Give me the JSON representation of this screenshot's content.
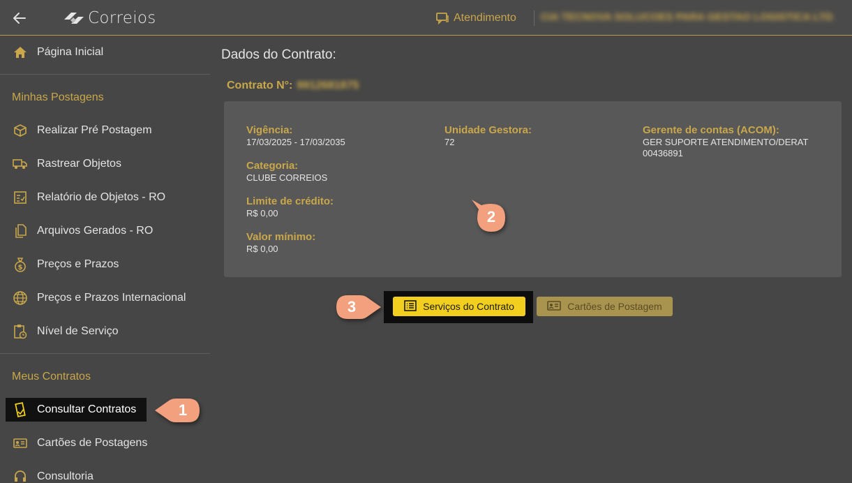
{
  "header": {
    "logo_text": "Correios",
    "atendimento_label": "Atendimento",
    "company_name": "CIA TECNOVA SOLUCOES PARA GESTAO LOGISTICA LTDA"
  },
  "sidebar": {
    "home_label": "Página Inicial",
    "section_postagens": "Minhas Postagens",
    "items_postagens": [
      {
        "label": "Realizar Pré Postagem",
        "icon": "box-icon"
      },
      {
        "label": "Rastrear Objetos",
        "icon": "truck-icon"
      },
      {
        "label": "Relatório de Objetos - RO",
        "icon": "checklist-icon"
      },
      {
        "label": "Arquivos Gerados - RO",
        "icon": "files-icon"
      },
      {
        "label": "Preços e Prazos",
        "icon": "money-bag-icon"
      },
      {
        "label": "Preços e Prazos Internacional",
        "icon": "globe-icon"
      },
      {
        "label": "Nível de Serviço",
        "icon": "clipboard-clock-icon"
      }
    ],
    "section_contratos": "Meus Contratos",
    "items_contratos": [
      {
        "label": "Consultar Contratos",
        "icon": "contract-icon"
      },
      {
        "label": "Cartões de Postagens",
        "icon": "id-card-icon"
      },
      {
        "label": "Consultoria",
        "icon": "headset-icon"
      }
    ]
  },
  "main": {
    "title": "Dados do Contrato:",
    "contract_label": "Contrato N°:",
    "contract_number": "9912681875",
    "fields": {
      "vigencia_label": "Vigência:",
      "vigencia_value": "17/03/2025 - 17/03/2035",
      "categoria_label": "Categoria:",
      "categoria_value": "CLUBE CORREIOS",
      "limite_label": "Limite de crédito:",
      "limite_value": "R$ 0,00",
      "valor_min_label": "Valor mínimo:",
      "valor_min_value": "R$ 0,00",
      "unidade_label": "Unidade Gestora:",
      "unidade_value": "72",
      "gerente_label": "Gerente de contas (ACOM):",
      "gerente_value_1": "GER SUPORTE ATENDIMENTO/DERAT",
      "gerente_value_2": "00436891"
    },
    "buttons": {
      "servicos": "Serviços do Contrato",
      "cartoes": "Cartões de Postagem"
    }
  },
  "callouts": [
    "1",
    "2",
    "3"
  ],
  "colors": {
    "accent": "#c9a74a",
    "primary_button": "#f2cf1e",
    "callout": "#f2a07e",
    "background": "#464646"
  }
}
